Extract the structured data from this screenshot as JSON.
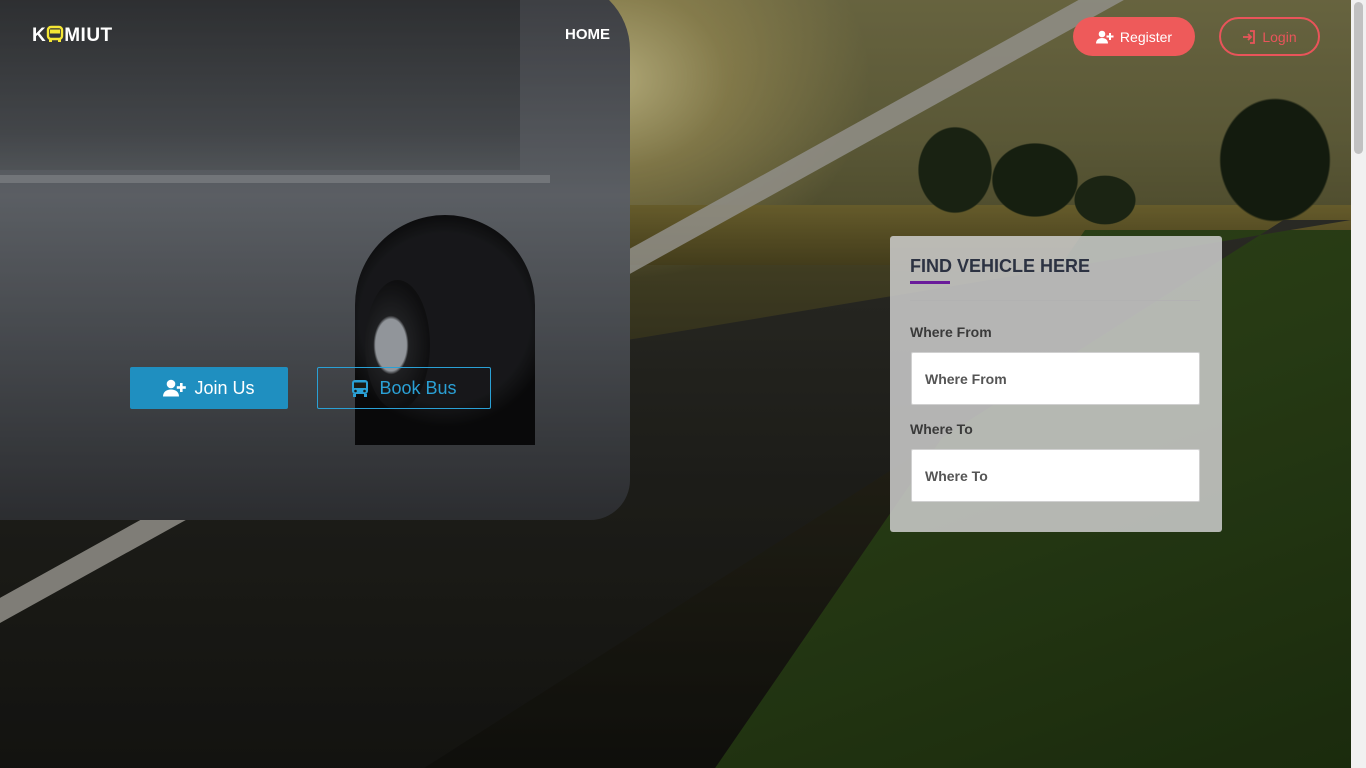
{
  "brand": {
    "logo_prefix": "K",
    "logo_suffix": "MIUT",
    "logo_icon": "bus-icon",
    "accent": "#f5e634"
  },
  "nav": {
    "home_label": "HOME",
    "register_label": "Register",
    "register_icon": "user-plus-icon",
    "login_label": "Login",
    "login_icon": "sign-in-icon",
    "register_color": "#ee5a5a"
  },
  "hero": {
    "join_label": "Join Us",
    "join_icon": "user-plus-icon",
    "book_label": "Book Bus",
    "book_icon": "bus-icon",
    "primary_color": "#1f8fc0"
  },
  "search": {
    "title": "FIND VEHICLE HERE",
    "from_label": "Where From",
    "from_placeholder": "Where From",
    "to_label": "Where To",
    "to_placeholder": "Where To",
    "accent": "#6a1b9a"
  }
}
